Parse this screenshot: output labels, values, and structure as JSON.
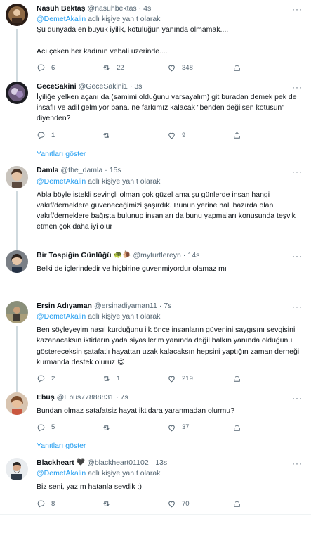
{
  "colors": {
    "accent": "#1d9bf0",
    "secondary_text": "#536471",
    "divider": "#eff3f4"
  },
  "tweets": [
    {
      "name": "Nasuh Bektaş",
      "name_emoji": "",
      "handle": "@nasuhbektas",
      "time": "4s",
      "reply_prefix": "",
      "mention": "",
      "reply_suffix": "",
      "text": "Şu dünyada en büyük iyilik, kötülüğün yanında olmamak....\n\nAcı çeken her kadının vebali üzerinde....",
      "replies": "6",
      "retweets": "22",
      "likes": "348"
    },
    {
      "name": "GeceSakini",
      "name_emoji": "",
      "handle": "@GeceSakini1",
      "time": "3s",
      "reply_prefix": "",
      "mention": "",
      "reply_suffix": "",
      "text": "İyiliğe yelken açanı da (samimi olduğunu varsayalım) git buradan demek pek de insaflı ve adil gelmiyor bana. ne farkımız kalacak \"benden değilsen kötüsün\" diyenden?",
      "replies": "1",
      "retweets": "",
      "likes": "9"
    },
    {
      "name": "Damla",
      "name_emoji": "",
      "handle": "@the_damla",
      "time": "15s",
      "reply_prefix": "",
      "mention": "@DemetAkalin",
      "reply_suffix": "adlı kişiye yanıt olarak",
      "text": "Abla böyle istekli sevinçli olman çok güzel ama  şu günlerde insan hangi vakıf/derneklere güveneceğimizi şaşırdık. Bunun yerine hali hazırda olan vakıf/derneklere bağışta bulunup insanları da bunu yapmaları konusunda teşvik etmen çok daha iyi olur",
      "replies": "",
      "retweets": "",
      "likes": ""
    },
    {
      "name": "Bir Tospiğin Günlüğü",
      "name_emoji": "🐢🐌",
      "handle": "@myturtlereyn",
      "time": "14s",
      "reply_prefix": "",
      "mention": "",
      "reply_suffix": "",
      "text": "Belki de içlerindedir ve hiçbirine guvenmiyordur olamaz mı",
      "replies": "",
      "retweets": "",
      "likes": ""
    },
    {
      "name": "Ersin Adıyaman",
      "name_emoji": "",
      "handle": "@ersinadiyaman11",
      "time": "7s",
      "reply_prefix": "",
      "mention": "@DemetAkalin",
      "reply_suffix": "adlı kişiye yanıt olarak",
      "text": "Ben söyleyeyim nasıl kurduğunu ilk önce insanların güvenini saygısını sevgisini kazanacaksın iktidarın yada siyasilerim yanında değil halkın yanında olduğunu göstereceksin şatafatlı hayattan uzak kalacaksın hepsini yaptığın zaman derneği kurmanda destek oluruz 😉",
      "replies": "2",
      "retweets": "1",
      "likes": "219"
    },
    {
      "name": "Ebuş",
      "name_emoji": "",
      "handle": "@Ebus77888831",
      "time": "7s",
      "reply_prefix": "",
      "mention": "",
      "reply_suffix": "",
      "text": "Bundan olmaz satafatsiz hayat iktidara yaranmadan olurmu?",
      "replies": "5",
      "retweets": "",
      "likes": "37"
    },
    {
      "name": "Blackheart",
      "name_emoji": "🖤",
      "handle": "@blackheart01102",
      "time": "13s",
      "reply_prefix": "",
      "mention": "@DemetAkalin",
      "reply_suffix": "adlı kişiye yanıt olarak",
      "text": "Biz seni, yazım hatanla sevdik :)",
      "replies": "8",
      "retweets": "",
      "likes": "70"
    }
  ],
  "tweet1_reply": {
    "mention": "@DemetAkalin",
    "suffix": "adlı kişiye yanıt olarak"
  },
  "show_replies_label": "Yanıtları göster",
  "more_label": "···",
  "dot": "·"
}
